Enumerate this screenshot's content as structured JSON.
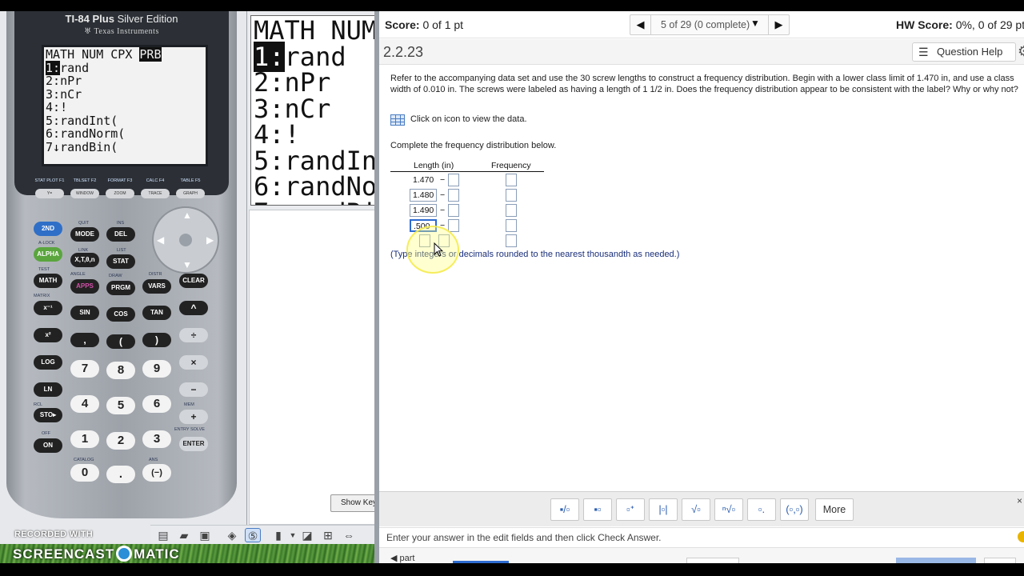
{
  "calculator": {
    "brand_main": "TI-84 Plus",
    "brand_edition": "Silver Edition",
    "maker": "Texas Instruments",
    "screen_tabs": [
      "MATH",
      "NUM",
      "CPX"
    ],
    "screen_active_tab": "PRB",
    "screen_lines": [
      {
        "n": "1",
        "sep": ":",
        "text": "rand",
        "highlight": true
      },
      {
        "n": "2",
        "sep": ":",
        "text": "nPr"
      },
      {
        "n": "3",
        "sep": ":",
        "text": "nCr"
      },
      {
        "n": "4",
        "sep": ":",
        "text": "!"
      },
      {
        "n": "5",
        "sep": ":",
        "text": "randInt("
      },
      {
        "n": "6",
        "sep": ":",
        "text": "randNorm("
      },
      {
        "n": "7",
        "sep": "↓",
        "text": "randBin("
      }
    ],
    "fkeys": [
      {
        "top": "STAT PLOT F1",
        "key": "Y="
      },
      {
        "top": "TBLSET F2",
        "key": "WINDOW"
      },
      {
        "top": "FORMAT F3",
        "key": "ZOOM"
      },
      {
        "top": "CALC F4",
        "key": "TRACE"
      },
      {
        "top": "TABLE F5",
        "key": "GRAPH"
      }
    ],
    "keys": {
      "second": "2ND",
      "mode": "MODE",
      "del": "DEL",
      "alpha": "ALPHA",
      "xton": "X,T,θ,n",
      "stat": "STAT",
      "math": "MATH",
      "apps": "APPS",
      "prgm": "PRGM",
      "vars": "VARS",
      "clear": "CLEAR",
      "xinv": "x⁻¹",
      "sin": "SIN",
      "cos": "COS",
      "tan": "TAN",
      "pow": "^",
      "xsq": "x²",
      "comma": ",",
      "lparen": "(",
      "rparen": ")",
      "div": "÷",
      "log": "LOG",
      "ln": "LN",
      "sto": "STO▸",
      "on": "ON",
      "enter": "ENTER",
      "mul": "×",
      "sub": "−",
      "add": "+",
      "neg": "(−)",
      "dot": ".",
      "n7": "7",
      "n8": "8",
      "n9": "9",
      "n4": "4",
      "n5": "5",
      "n6": "6",
      "n1": "1",
      "n2": "2",
      "n3": "3",
      "n0": "0"
    },
    "sublabels": {
      "quit": "QUIT",
      "ins": "INS",
      "alock": "A-LOCK",
      "link": "LINK",
      "list": "LIST",
      "test": "TEST",
      "angle": "ANGLE",
      "draw": "DRAW",
      "distr": "DISTR",
      "matrix": "MATRIX",
      "catalog": "CATALOG",
      "off": "OFF",
      "ans": "ANS",
      "entry_solve": "ENTRY SOLVE",
      "rcl": "RCL",
      "mem": "MEM"
    }
  },
  "zoom_panel": {
    "show_keypad_label": "Show Key"
  },
  "recorder": {
    "line1": "RECORDED WITH",
    "line2a": "SCREENCAST",
    "line2b": "MATIC"
  },
  "mml": {
    "score": {
      "label": "Score:",
      "value": "0 of 1 pt"
    },
    "nav": {
      "label": "5 of 29 (0 complete)"
    },
    "hw_score": {
      "label": "HW Score:",
      "value": "0%, 0 of 29 pt"
    },
    "question_number": "2.2.23",
    "question_help": "Question Help",
    "question_text": "Refer to the accompanying data set and use the 30 screw lengths to construct a frequency distribution. Begin with a lower class limit of 1.470 in, and use a class width of 0.010 in. The screws were labeled as having a length of 1 1/2 in. Does the frequency distribution appear to be consistent with the label? Why or why not?",
    "data_link": "Click on icon to view the data.",
    "complete_prompt": "Complete the frequency distribution below.",
    "table": {
      "header_length": "Length (in)",
      "header_frequency": "Frequency",
      "dash": "−",
      "rows": [
        {
          "lower": "1.470",
          "editable": false
        },
        {
          "lower": "1.480",
          "editable": true
        },
        {
          "lower": "1.490",
          "editable": true
        },
        {
          "lower": ".500",
          "editable": true,
          "active": true
        },
        {
          "lower": "",
          "editable": true
        }
      ]
    },
    "note": "(Type integers or decimals rounded to the nearest thousandth as needed.)",
    "palette": {
      "more": "More",
      "close": "×"
    },
    "instructions": "Enter your answer in the edit fields and then click Check Answer.",
    "footer_part": "part"
  },
  "colors": {
    "accent_blue": "#2d6bd1",
    "note_blue": "#1a2f7a",
    "calc_body": "#9da2a9"
  }
}
